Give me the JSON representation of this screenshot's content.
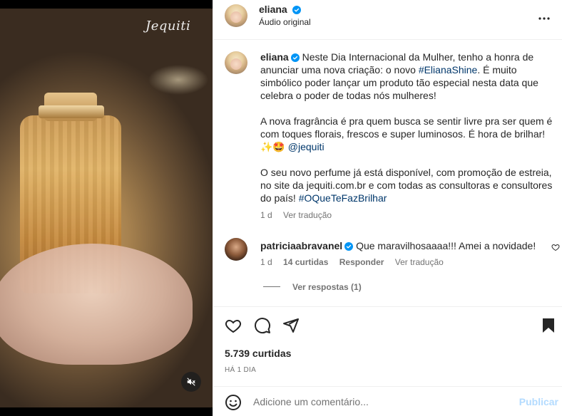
{
  "media": {
    "watermark": "Jequiti",
    "mute_icon": "speaker-muted-icon"
  },
  "header": {
    "username": "eliana",
    "audio": "Áudio original",
    "more_icon": "more-horizontal-icon"
  },
  "caption": {
    "username": "eliana",
    "p1_text": "Neste Dia Internacional da Mulher, tenho a honra de anunciar uma nova criação: o novo ",
    "p1_hashtag": "#ElianaShine",
    "p1_rest": ". É muito simbólico poder lançar um produto tão especial nesta data que celebra o poder de todas nós mulheres!",
    "p2_text": "A nova fragrância é pra quem busca se sentir livre pra ser quem é com toques florais, frescos e super luminosos. É hora de brilhar! ✨🤩 ",
    "p2_mention": "@jequiti",
    "p3_text": "O seu novo perfume já está disponível, com promoção de estreia, no site da jequiti.com.br e com todas as consultoras e consultores do país! ",
    "p3_hashtag": "#OQueTeFazBrilhar",
    "time": "1 d",
    "see_translation": "Ver tradução"
  },
  "comment": {
    "username": "patriciaabravanel",
    "text": "Que maravilhosaaaa!!! Amei a novidade!",
    "time": "1 d",
    "likes": "14 curtidas",
    "reply": "Responder",
    "see_translation": "Ver tradução",
    "view_replies": "Ver respostas (1)"
  },
  "actions": {
    "likes": "5.739 curtidas",
    "date": "HÁ 1 DIA"
  },
  "add_comment": {
    "placeholder": "Adicione um comentário...",
    "publish": "Publicar"
  },
  "colors": {
    "verified": "#0095f6",
    "link": "#00376b",
    "publish_disabled": "#b3dbff",
    "muted_text": "#737373"
  }
}
